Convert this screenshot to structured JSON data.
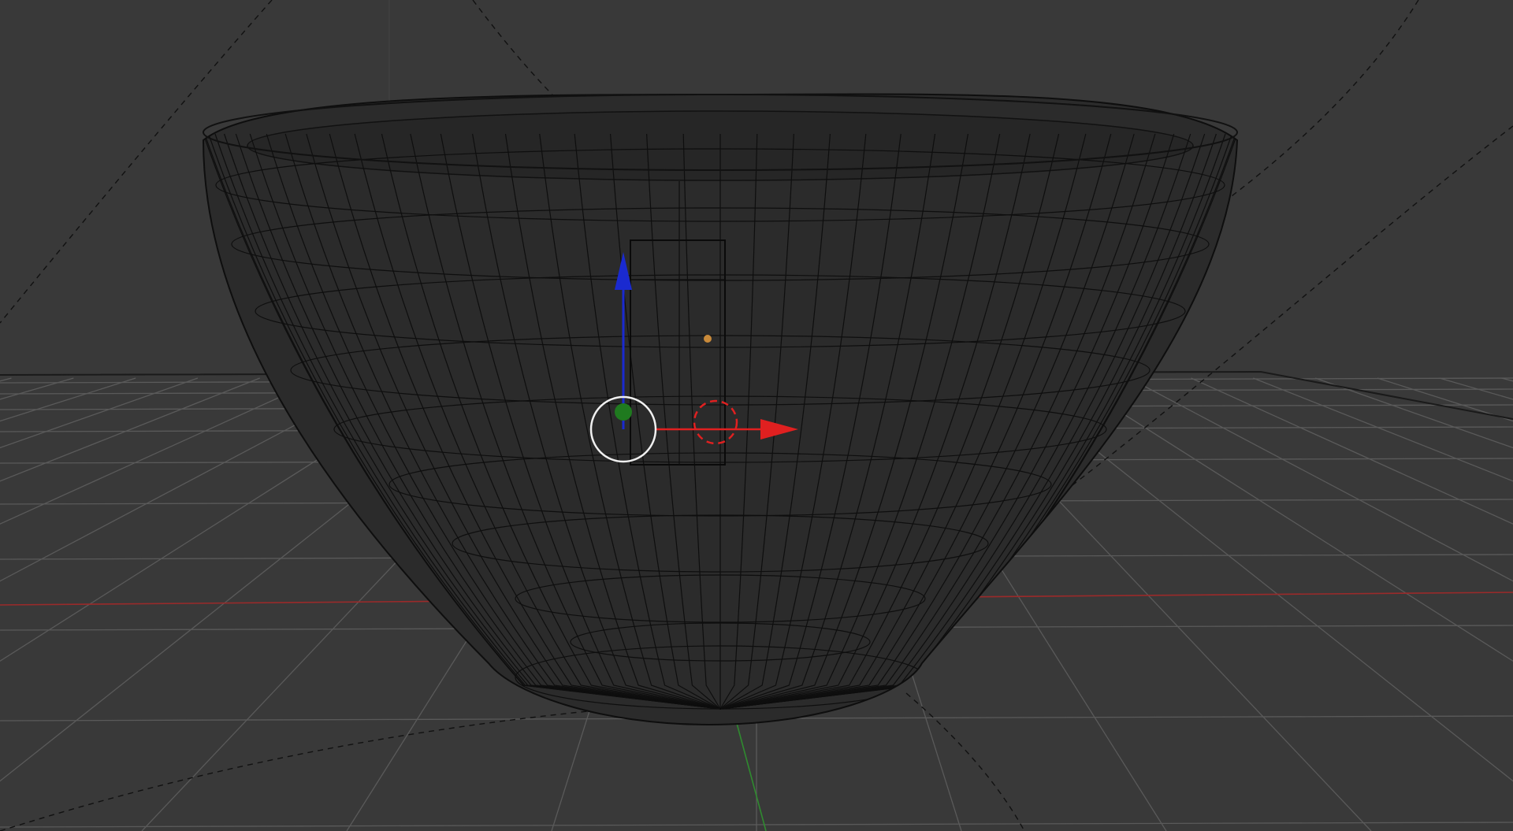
{
  "viewport": {
    "background_color": "#393939",
    "grid_line_color": "#5a5a5a",
    "horizon_line_color": "#1a1a1a",
    "x_axis_color": "#9b2a2a",
    "y_axis_color": "#2f8a2f",
    "dashed_guide_color": "#111111"
  },
  "mesh": {
    "object": "bowl",
    "display_mode": "wireframe",
    "fill_color": "#2b2b2b",
    "wire_color": "#0e0e0e"
  },
  "gizmo": {
    "mode": "translate",
    "x_axis_color": "#e02020",
    "z_axis_color": "#1a2ad0",
    "center_dot_color": "#1f7a1f",
    "ring_color": "#f0f0f0"
  },
  "origin_point": {
    "color": "#c98a3a"
  }
}
